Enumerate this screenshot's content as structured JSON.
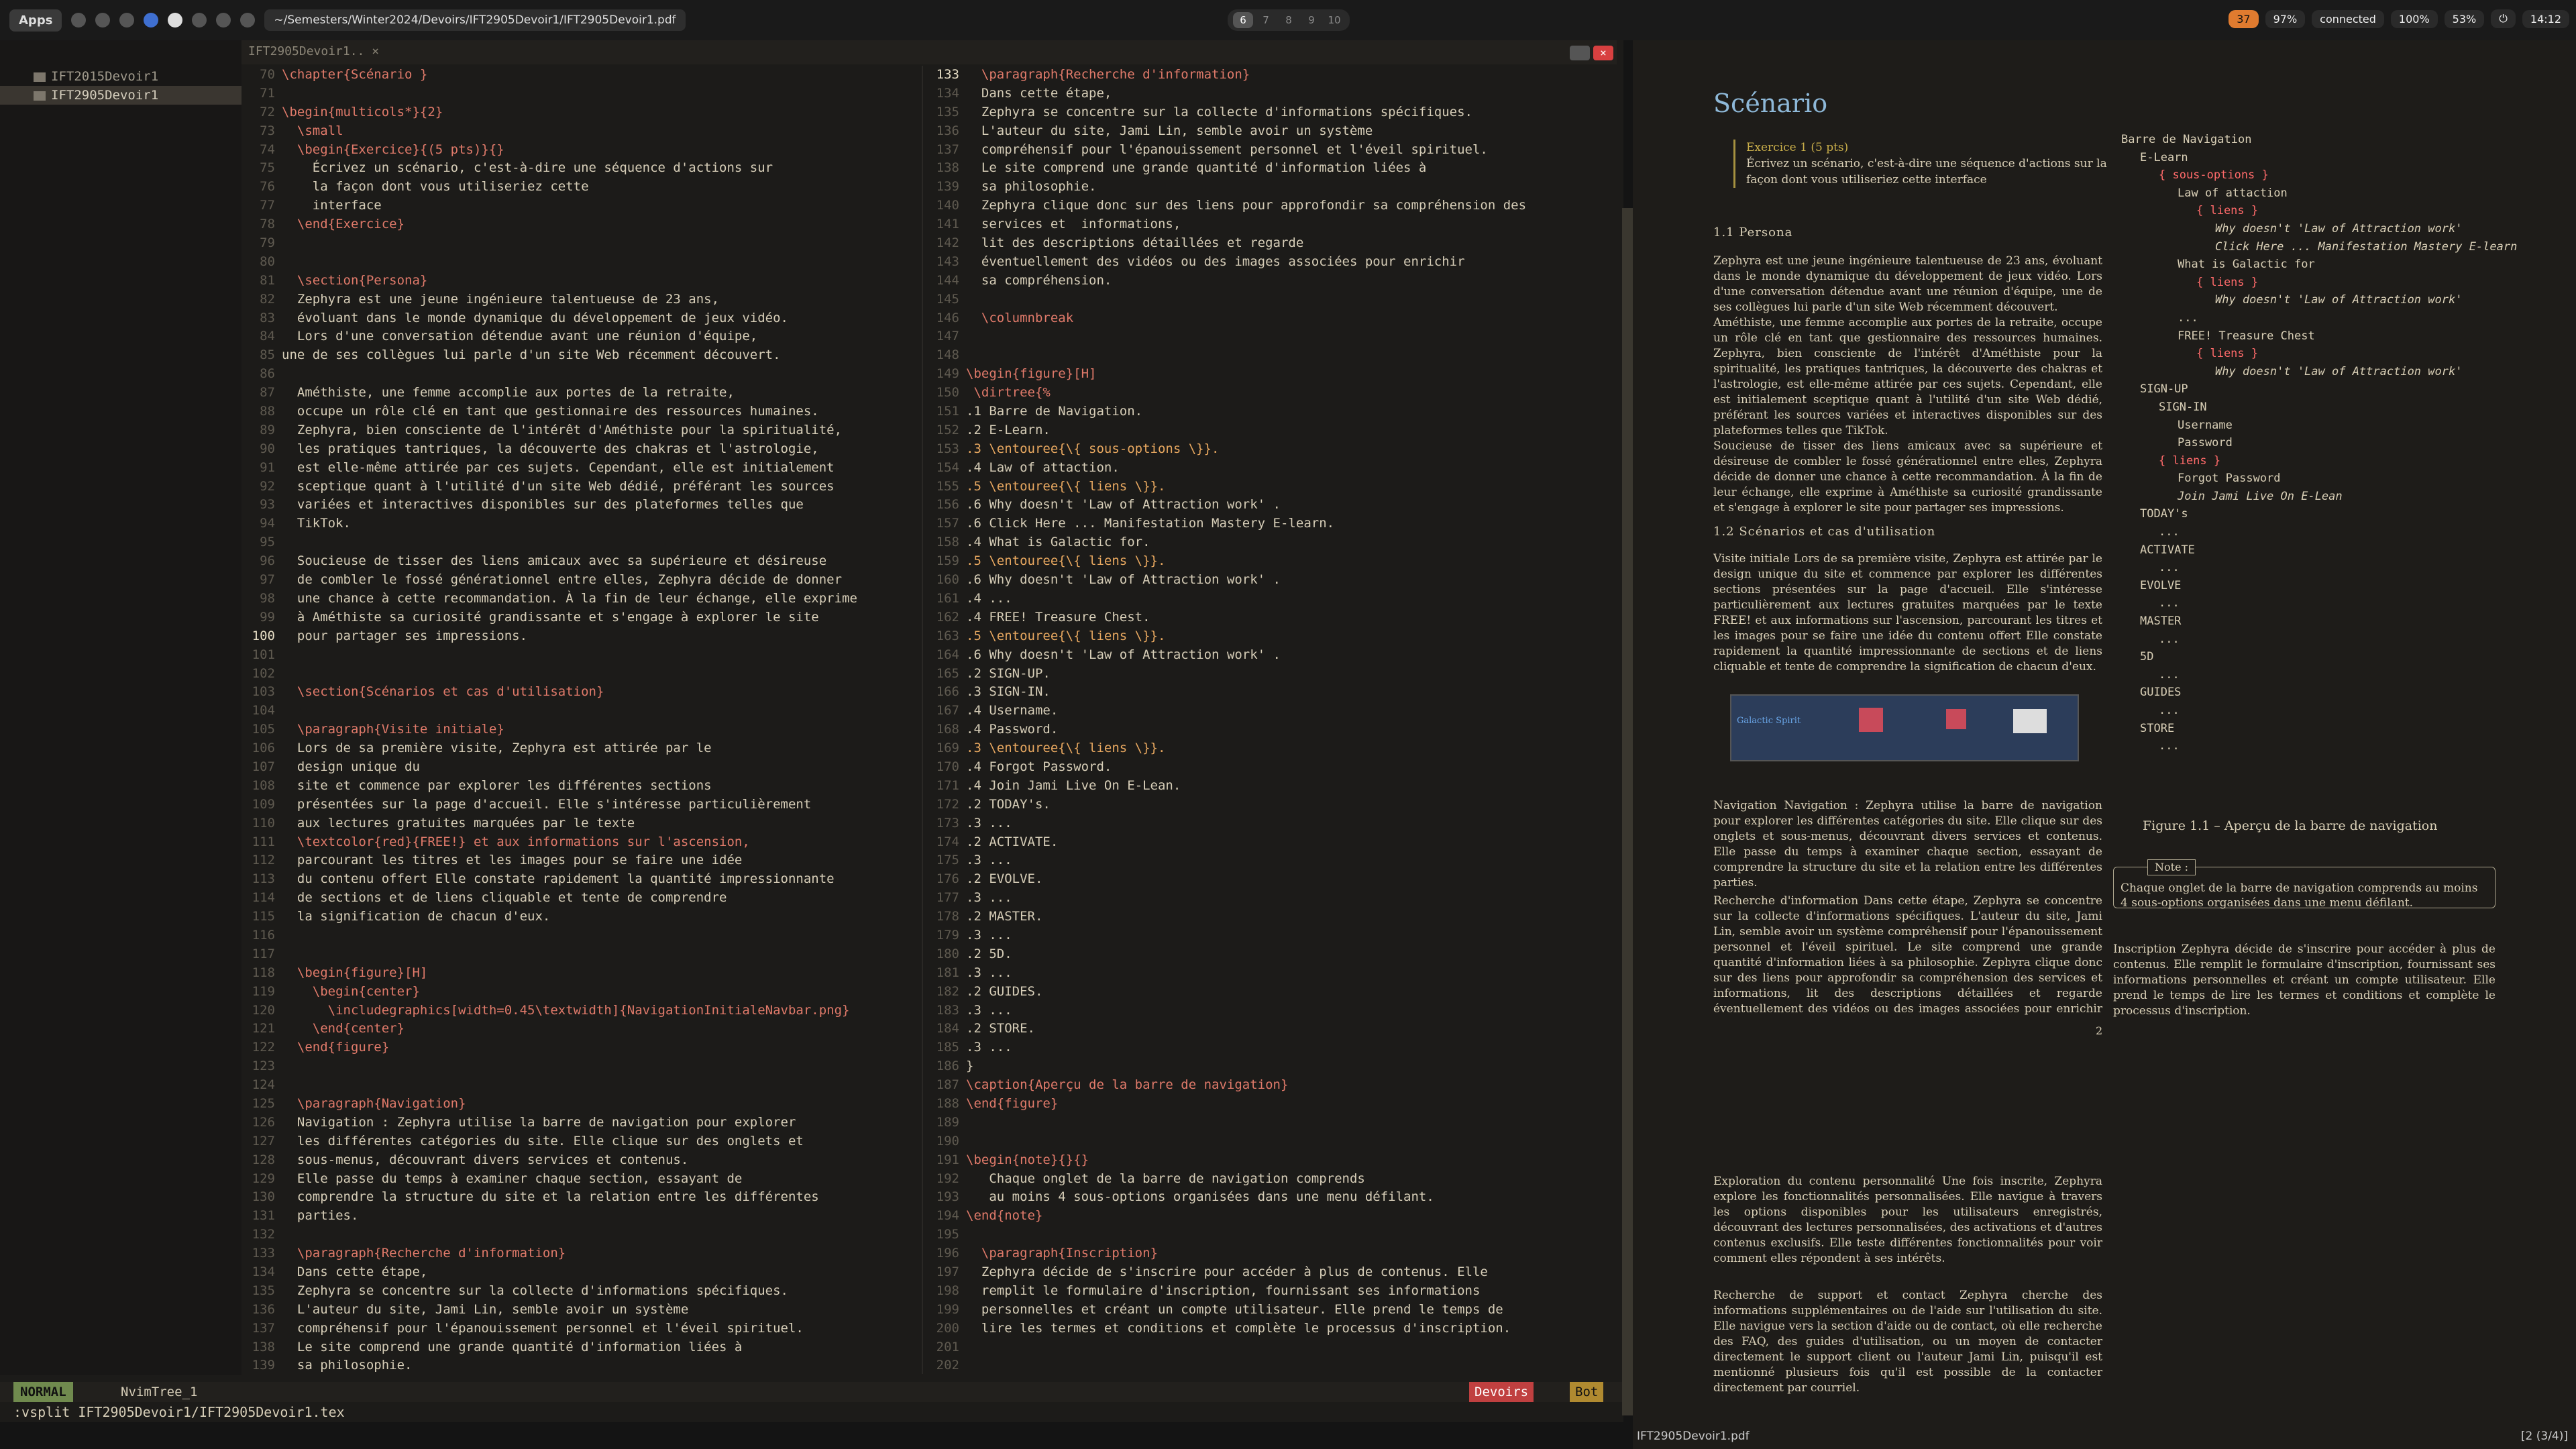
{
  "topbar": {
    "apps": "Apps",
    "path": "~/Semesters/Winter2024/Devoirs/IFT2905Devoir1/IFT2905Devoir1.pdf",
    "workspaces": [
      "6",
      "7",
      "8",
      "9",
      "10"
    ],
    "updates": "37",
    "volume": "97%",
    "network": "connected",
    "battery": "100%",
    "wifi": "53%",
    "clock": "14:12"
  },
  "tree": {
    "items": [
      "IFT2015Devoir1",
      "IFT2905Devoir1"
    ]
  },
  "tab": {
    "label": "IFT2905Devoir1.."
  },
  "editor": {
    "pane_left": [
      {
        "n": "70",
        "t": "\\chapter{Scénario }",
        "c": "cmd"
      },
      {
        "n": "71",
        "t": ""
      },
      {
        "n": "72",
        "t": "\\begin{multicols*}{2}",
        "c": "cmd"
      },
      {
        "n": "73",
        "t": "  \\small",
        "c": "cmd"
      },
      {
        "n": "74",
        "t": "  \\begin{Exercice}{(5 pts)}{}",
        "c": "cmd"
      },
      {
        "n": "75",
        "t": "    Écrivez un scénario, c'est-à-dire une séquence d'actions sur"
      },
      {
        "n": "76",
        "t": "    la façon dont vous utiliseriez cette"
      },
      {
        "n": "77",
        "t": "    interface"
      },
      {
        "n": "78",
        "t": "  \\end{Exercice}",
        "c": "cmd"
      },
      {
        "n": "79",
        "t": ""
      },
      {
        "n": "80",
        "t": ""
      },
      {
        "n": "81",
        "t": "  \\section{Persona}",
        "c": "cmd"
      },
      {
        "n": "82",
        "t": "  Zephyra est une jeune ingénieure talentueuse de 23 ans,"
      },
      {
        "n": "83",
        "t": "  évoluant dans le monde dynamique du développement de jeux vidéo."
      },
      {
        "n": "84",
        "t": "  Lors d'une conversation détendue avant une réunion d'équipe,"
      },
      {
        "n": "85",
        "t": "une de ses collègues lui parle d'un site Web récemment découvert."
      },
      {
        "n": "86",
        "t": ""
      },
      {
        "n": "87",
        "t": "  Améthiste, une femme accomplie aux portes de la retraite,"
      },
      {
        "n": "88",
        "t": "  occupe un rôle clé en tant que gestionnaire des ressources humaines."
      },
      {
        "n": "89",
        "t": "  Zephyra, bien consciente de l'intérêt d'Améthiste pour la spiritualité,"
      },
      {
        "n": "90",
        "t": "  les pratiques tantriques, la découverte des chakras et l'astrologie,"
      },
      {
        "n": "91",
        "t": "  est elle-même attirée par ces sujets. Cependant, elle est initialement"
      },
      {
        "n": "92",
        "t": "  sceptique quant à l'utilité d'un site Web dédié, préférant les sources"
      },
      {
        "n": "93",
        "t": "  variées et interactives disponibles sur des plateformes telles que"
      },
      {
        "n": "94",
        "t": "  TikTok."
      },
      {
        "n": "95",
        "t": ""
      },
      {
        "n": "96",
        "t": "  Soucieuse de tisser des liens amicaux avec sa supérieure et désireuse"
      },
      {
        "n": "97",
        "t": "  de combler le fossé générationnel entre elles, Zephyra décide de donner"
      },
      {
        "n": "98",
        "t": "  une chance à cette recommandation. À la fin de leur échange, elle exprime"
      },
      {
        "n": "99",
        "t": "  à Améthiste sa curiosité grandissante et s'engage à explorer le site"
      },
      {
        "n": "100",
        "t": "  pour partager ses impressions.",
        "cur": true
      },
      {
        "n": "101",
        "t": ""
      },
      {
        "n": "102",
        "t": ""
      },
      {
        "n": "103",
        "t": "  \\section{Scénarios et cas d'utilisation}",
        "c": "cmd"
      },
      {
        "n": "104",
        "t": ""
      },
      {
        "n": "105",
        "t": "  \\paragraph{Visite initiale}",
        "c": "cmd"
      },
      {
        "n": "106",
        "t": "  Lors de sa première visite, Zephyra est attirée par le"
      },
      {
        "n": "107",
        "t": "  design unique du"
      },
      {
        "n": "108",
        "t": "  site et commence par explorer les différentes sections"
      },
      {
        "n": "109",
        "t": "  présentées sur la page d'accueil. Elle s'intéresse particulièrement"
      },
      {
        "n": "110",
        "t": "  aux lectures gratuites marquées par le texte"
      },
      {
        "n": "111",
        "t": "  \\textcolor{red}{FREE!} et aux informations sur l'ascension,",
        "c": "cmd"
      },
      {
        "n": "112",
        "t": "  parcourant les titres et les images pour se faire une idée"
      },
      {
        "n": "113",
        "t": "  du contenu offert Elle constate rapidement la quantité impressionnante"
      },
      {
        "n": "114",
        "t": "  de sections et de liens cliquable et tente de comprendre"
      },
      {
        "n": "115",
        "t": "  la signification de chacun d'eux."
      },
      {
        "n": "116",
        "t": ""
      },
      {
        "n": "117",
        "t": ""
      },
      {
        "n": "118",
        "t": "  \\begin{figure}[H]",
        "c": "cmd"
      },
      {
        "n": "119",
        "t": "    \\begin{center}",
        "c": "cmd"
      },
      {
        "n": "120",
        "t": "      \\includegraphics[width=0.45\\textwidth]{NavigationInitialeNavbar.png}",
        "c": "cmd"
      },
      {
        "n": "121",
        "t": "    \\end{center}",
        "c": "cmd"
      },
      {
        "n": "122",
        "t": "  \\end{figure}",
        "c": "cmd"
      },
      {
        "n": "123",
        "t": ""
      },
      {
        "n": "124",
        "t": ""
      },
      {
        "n": "125",
        "t": "  \\paragraph{Navigation}",
        "c": "cmd"
      },
      {
        "n": "126",
        "t": "  Navigation : Zephyra utilise la barre de navigation pour explorer"
      },
      {
        "n": "127",
        "t": "  les différentes catégories du site. Elle clique sur des onglets et"
      },
      {
        "n": "128",
        "t": "  sous-menus, découvrant divers services et contenus."
      },
      {
        "n": "129",
        "t": "  Elle passe du temps à examiner chaque section, essayant de"
      },
      {
        "n": "130",
        "t": "  comprendre la structure du site et la relation entre les différentes"
      },
      {
        "n": "131",
        "t": "  parties."
      },
      {
        "n": "132",
        "t": ""
      },
      {
        "n": "133",
        "t": "  \\paragraph{Recherche d'information}",
        "c": "cmd"
      },
      {
        "n": "134",
        "t": "  Dans cette étape,"
      },
      {
        "n": "135",
        "t": "  Zephyra se concentre sur la collecte d'informations spécifiques."
      },
      {
        "n": "136",
        "t": "  L'auteur du site, Jami Lin, semble avoir un système"
      },
      {
        "n": "137",
        "t": "  compréhensif pour l'épanouissement personnel et l'éveil spirituel."
      },
      {
        "n": "138",
        "t": "  Le site comprend une grande quantité d'information liées à"
      },
      {
        "n": "139",
        "t": "  sa philosophie."
      }
    ],
    "pane_right": [
      {
        "n": "133",
        "t": "  \\paragraph{Recherche d'information}",
        "c": "cmd",
        "cur": true
      },
      {
        "n": "134",
        "t": "  Dans cette étape,"
      },
      {
        "n": "135",
        "t": "  Zephyra se concentre sur la collecte d'informations spécifiques."
      },
      {
        "n": "136",
        "t": "  L'auteur du site, Jami Lin, semble avoir un système"
      },
      {
        "n": "137",
        "t": "  compréhensif pour l'épanouissement personnel et l'éveil spirituel."
      },
      {
        "n": "138",
        "t": "  Le site comprend une grande quantité d'information liées à"
      },
      {
        "n": "139",
        "t": "  sa philosophie."
      },
      {
        "n": "140",
        "t": "  Zephyra clique donc sur des liens pour approfondir sa compréhension des"
      },
      {
        "n": "141",
        "t": "  services et  informations,"
      },
      {
        "n": "142",
        "t": "  lit des descriptions détaillées et regarde"
      },
      {
        "n": "143",
        "t": "  éventuellement des vidéos ou des images associées pour enrichir"
      },
      {
        "n": "144",
        "t": "  sa compréhension."
      },
      {
        "n": "145",
        "t": ""
      },
      {
        "n": "146",
        "t": "  \\columnbreak",
        "c": "cmd"
      },
      {
        "n": "147",
        "t": ""
      },
      {
        "n": "148",
        "t": ""
      },
      {
        "n": "149",
        "t": "\\begin{figure}[H]",
        "c": "cmd"
      },
      {
        "n": "150",
        "t": " \\dirtree{%",
        "c": "cmd"
      },
      {
        "n": "151",
        "t": ".1 Barre de Navigation."
      },
      {
        "n": "152",
        "t": ".2 E-Learn."
      },
      {
        "n": "153",
        "t": ".3 \\entouree{\\{ sous-options \\}}.",
        "c": "kw"
      },
      {
        "n": "154",
        "t": ".4 Law of attaction."
      },
      {
        "n": "155",
        "t": ".5 \\entouree{\\{ liens \\}}.",
        "c": "kw"
      },
      {
        "n": "156",
        "t": ".6 Why doesn't 'Law of Attraction work' ."
      },
      {
        "n": "157",
        "t": ".6 Click Here ... Manifestation Mastery E-learn."
      },
      {
        "n": "158",
        "t": ".4 What is Galactic for."
      },
      {
        "n": "159",
        "t": ".5 \\entouree{\\{ liens \\}}.",
        "c": "kw"
      },
      {
        "n": "160",
        "t": ".6 Why doesn't 'Law of Attraction work' ."
      },
      {
        "n": "161",
        "t": ".4 ..."
      },
      {
        "n": "162",
        "t": ".4 FREE! Treasure Chest."
      },
      {
        "n": "163",
        "t": ".5 \\entouree{\\{ liens \\}}.",
        "c": "kw"
      },
      {
        "n": "164",
        "t": ".6 Why doesn't 'Law of Attraction work' ."
      },
      {
        "n": "165",
        "t": ".2 SIGN-UP."
      },
      {
        "n": "166",
        "t": ".3 SIGN-IN."
      },
      {
        "n": "167",
        "t": ".4 Username."
      },
      {
        "n": "168",
        "t": ".4 Password."
      },
      {
        "n": "169",
        "t": ".3 \\entouree{\\{ liens \\}}.",
        "c": "kw"
      },
      {
        "n": "170",
        "t": ".4 Forgot Password."
      },
      {
        "n": "171",
        "t": ".4 Join Jami Live On E-Lean."
      },
      {
        "n": "172",
        "t": ".2 TODAY's."
      },
      {
        "n": "173",
        "t": ".3 ..."
      },
      {
        "n": "174",
        "t": ".2 ACTIVATE."
      },
      {
        "n": "175",
        "t": ".3 ..."
      },
      {
        "n": "176",
        "t": ".2 EVOLVE."
      },
      {
        "n": "177",
        "t": ".3 ..."
      },
      {
        "n": "178",
        "t": ".2 MASTER."
      },
      {
        "n": "179",
        "t": ".3 ..."
      },
      {
        "n": "180",
        "t": ".2 5D."
      },
      {
        "n": "181",
        "t": ".3 ..."
      },
      {
        "n": "182",
        "t": ".2 GUIDES."
      },
      {
        "n": "183",
        "t": ".3 ..."
      },
      {
        "n": "184",
        "t": ".2 STORE."
      },
      {
        "n": "185",
        "t": ".3 ..."
      },
      {
        "n": "186",
        "t": "}"
      },
      {
        "n": "187",
        "t": "\\caption{Aperçu de la barre de navigation}",
        "c": "cmd"
      },
      {
        "n": "188",
        "t": "\\end{figure}",
        "c": "cmd"
      },
      {
        "n": "189",
        "t": ""
      },
      {
        "n": "190",
        "t": ""
      },
      {
        "n": "191",
        "t": "\\begin{note}{}{}",
        "c": "cmd"
      },
      {
        "n": "192",
        "t": "   Chaque onglet de la barre de navigation comprends"
      },
      {
        "n": "193",
        "t": "   au moins 4 sous-options organisées dans une menu défilant."
      },
      {
        "n": "194",
        "t": "\\end{note}",
        "c": "cmd"
      },
      {
        "n": "195",
        "t": ""
      },
      {
        "n": "196",
        "t": "  \\paragraph{Inscription}",
        "c": "cmd"
      },
      {
        "n": "197",
        "t": "  Zephyra décide de s'inscrire pour accéder à plus de contenus. Elle"
      },
      {
        "n": "198",
        "t": "  remplit le formulaire d'inscription, fournissant ses informations"
      },
      {
        "n": "199",
        "t": "  personnelles et créant un compte utilisateur. Elle prend le temps de"
      },
      {
        "n": "200",
        "t": "  lire les termes et conditions et complète le processus d'inscription."
      },
      {
        "n": "201",
        "t": ""
      },
      {
        "n": "202",
        "t": ""
      }
    ]
  },
  "statusline": {
    "mode": "NORMAL",
    "buffer": "NvimTree_1",
    "project": "Devoirs",
    "position": "Bot"
  },
  "cmdline": ":vsplit IFT2905Devoir1/IFT2905Devoir1.tex",
  "pdf": {
    "title": "Scénario",
    "exercise_head": "Exercice 1 (5 pts)",
    "exercise_body": "Écrivez un scénario, c'est-à-dire une séquence d'actions sur la façon dont vous utiliseriez cette interface",
    "sec_persona": "1.1   Persona",
    "p_persona1": "Zephyra est une jeune ingénieure talentueuse de 23 ans, évoluant dans le monde dynamique du développement de jeux vidéo. Lors d'une conversation détendue avant une réunion d'équipe, une de ses collègues lui parle d'un site Web récemment découvert.",
    "p_persona2": "Améthiste, une femme accomplie aux portes de la retraite, occupe un rôle clé en tant que gestionnaire des ressources humaines. Zephyra, bien consciente de l'intérêt d'Améthiste pour la spiritualité, les pratiques tantriques, la découverte des chakras et l'astrologie, est elle-même attirée par ces sujets. Cependant, elle est initialement sceptique quant à l'utilité d'un site Web dédié, préférant les sources variées et interactives disponibles sur des plateformes telles que TikTok.",
    "p_persona3": "Soucieuse de tisser des liens amicaux avec sa supérieure et désireuse de combler le fossé générationnel entre elles, Zephyra décide de donner une chance à cette recommandation. À la fin de leur échange, elle exprime à Améthiste sa curiosité grandissante et s'engage à explorer le site pour partager ses impressions.",
    "sec_scenarios": "1.2   Scénarios et cas d'utilisation",
    "p_visite": "Visite initiale   Lors de sa première visite, Zephyra est attirée par le design unique du site et commence par explorer les différentes sections présentées sur la page d'accueil. Elle s'intéresse particulièrement aux lectures gratuites marquées par le texte FREE! et aux informations sur l'ascension, parcourant les titres et les images pour se faire une idée du contenu offert Elle constate rapidement la quantité impressionnante de sections et de liens cliquable et tente de comprendre la signification de chacun d'eux.",
    "fig_text": "Galactic Spirit",
    "p_navigation": "Navigation   Navigation : Zephyra utilise la barre de navigation pour explorer les différentes catégories du site. Elle clique sur des onglets et sous-menus, découvrant divers services et contenus. Elle passe du temps à examiner chaque section, essayant de comprendre la structure du site et la relation entre les différentes parties.",
    "p_recherche": "Recherche d'information   Dans cette étape, Zephyra se concentre sur la collecte d'informations spécifiques. L'auteur du site, Jami Lin, semble avoir un système compréhensif pour l'épanouissement personnel et l'éveil spirituel. Le site comprend une grande quantité d'information liées à sa philosophie. Zephyra clique donc sur des liens pour approfondir sa compréhension des services et informations, lit des descriptions détaillées et regarde éventuellement des vidéos ou des images associées pour enrichir sa compréhension.",
    "nav_tree": [
      "Barre de Navigation",
      "E-Learn",
      "{ sous-options }",
      "Law of attaction",
      "{ liens }",
      "Why doesn't 'Law of Attraction work'",
      "Click Here ... Manifestation Mastery E-learn",
      "What is Galactic for",
      "{ liens }",
      "Why doesn't 'Law of Attraction work'",
      "...",
      "FREE! Treasure Chest",
      "{ liens }",
      "Why doesn't 'Law of Attraction work'",
      "SIGN-UP",
      "SIGN-IN",
      "Username",
      "Password",
      "{ liens }",
      "Forgot Password",
      "Join Jami Live On E-Lean",
      "TODAY's",
      "...",
      "ACTIVATE",
      "...",
      "EVOLVE",
      "...",
      "MASTER",
      "...",
      "5D",
      "...",
      "GUIDES",
      "...",
      "STORE",
      "..."
    ],
    "fig_caption": "Figure 1.1 – Aperçu de la barre de navigation",
    "note_tag": "Note :",
    "note_body": "Chaque onglet de la barre de navigation comprends au moins 4 sous-options organisées dans une menu défilant.",
    "p_inscription": "Inscription   Zephyra décide de s'inscrire pour accéder à plus de contenus. Elle remplit le formulaire d'inscription, fournissant ses informations personnelles et créant un compte utilisateur. Elle prend le temps de lire les termes et conditions et complète le processus d'inscription.",
    "page_number": "2",
    "p_exploration": "Exploration du contenu personnalité   Une fois inscrite, Zephyra explore les fonctionnalités personnalisées. Elle navigue à travers les options disponibles pour les utilisateurs enregistrés, découvrant des lectures personnalisées, des activations et d'autres contenus exclusifs. Elle teste différentes fonctionnalités pour voir comment elles répondent à ses intérêts.",
    "p_support": "Recherche de support et contact   Zephyra cherche des informations supplémentaires ou de l'aide sur l'utilisation du site. Elle navigue vers la section d'aide ou de contact, où elle recherche des FAQ, des guides d'utilisation, ou un moyen de contacter directement le support client ou l'auteur Jami Lin, puisqu'il est mentionné plusieurs fois qu'il est possible de la contacter directement par courriel.",
    "footer_file": "IFT2905Devoir1.pdf",
    "footer_page": "[2 (3/4)]"
  }
}
